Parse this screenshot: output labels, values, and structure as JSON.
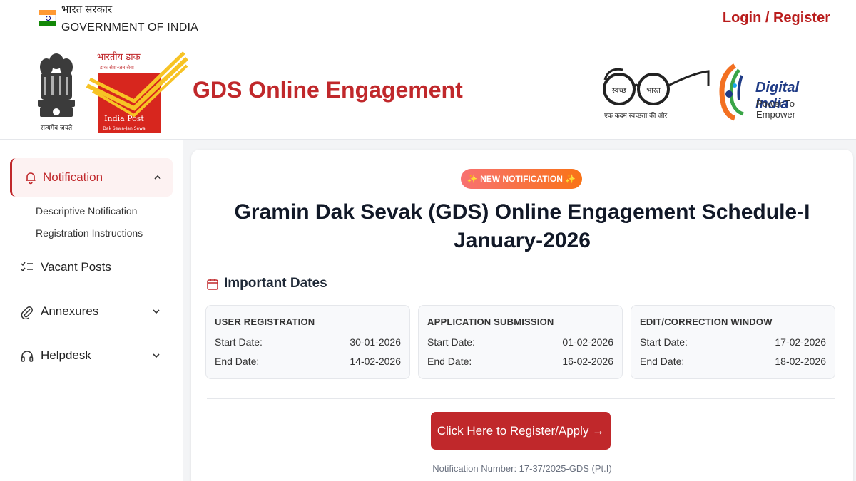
{
  "gov_bar": {
    "hindi_text": "भारत सरकार",
    "english_text": "GOVERNMENT OF INDIA",
    "login_label": "Login / Register"
  },
  "header": {
    "emblem_caption": "सत्यमेव जयते",
    "ip_logo_hindi": "भारतीय डाक",
    "ip_logo_tagline": "डाक सेवा-जन सेवा",
    "ip_logo_name": "India Post",
    "ip_logo_sub": "Dak Sewa-Jan Sewa",
    "portal_title": "GDS Online Engagement",
    "swachh_left": "स्वच्छ",
    "swachh_right": "भारत",
    "swachh_caption": "एक कदम स्वच्छता की ओर",
    "digital_india_title": "Digital India",
    "digital_india_sub": "Power To Empower"
  },
  "sidebar": {
    "notification_label": "Notification",
    "notification_subitems": [
      "Descriptive Notification",
      "Registration Instructions"
    ],
    "vacant_label": "Vacant Posts",
    "annexures_label": "Annexures",
    "helpdesk_label": "Helpdesk"
  },
  "main": {
    "badge": "✨ NEW NOTIFICATION ✨",
    "title_line1": "Gramin Dak Sevak (GDS) Online Engagement Schedule-I",
    "title_line2": "January-2026",
    "dates_heading": "Important Dates",
    "date_cards": [
      {
        "heading": "USER REGISTRATION",
        "start_label": "Start Date:",
        "start": "30-01-2026",
        "end_label": "End Date:",
        "end": "14-02-2026"
      },
      {
        "heading": "APPLICATION SUBMISSION",
        "start_label": "Start Date:",
        "start": "01-02-2026",
        "end_label": "End Date:",
        "end": "16-02-2026"
      },
      {
        "heading": "EDIT/CORRECTION WINDOW",
        "start_label": "Start Date:",
        "start": "17-02-2026",
        "end_label": "End Date:",
        "end": "18-02-2026"
      }
    ],
    "cta_label": "Click Here to Register/Apply →",
    "notification_number": "Notification Number: 17-37/2025-GDS (Pt.I)"
  },
  "colors": {
    "brand_red": "#c0282b",
    "badge_gradient_start": "#f87171",
    "badge_gradient_end": "#f97316",
    "digital_india_blue": "#1f3b86"
  }
}
